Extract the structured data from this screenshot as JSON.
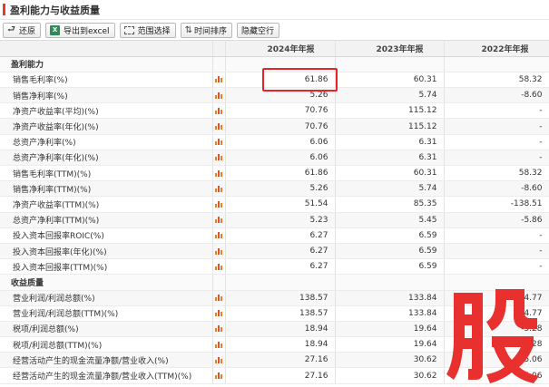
{
  "title": "盈利能力与收益质量",
  "toolbar": {
    "restore": "还原",
    "export": "导出到excel",
    "range": "范围选择",
    "sort": "时间排序",
    "hide_empty": "隐藏空行"
  },
  "columns": [
    "2024年年报",
    "2023年年报",
    "2022年年报"
  ],
  "rows": [
    {
      "section": true,
      "label": "盈利能力"
    },
    {
      "label": "销售毛利率(%)",
      "values": [
        "61.86",
        "60.31",
        "58.32"
      ]
    },
    {
      "label": "销售净利率(%)",
      "values": [
        "5.26",
        "5.74",
        "-8.60"
      ]
    },
    {
      "label": "净资产收益率(平均)(%)",
      "values": [
        "70.76",
        "115.12",
        "-"
      ]
    },
    {
      "label": "净资产收益率(年化)(%)",
      "values": [
        "70.76",
        "115.12",
        "-"
      ]
    },
    {
      "label": "总资产净利率(%)",
      "values": [
        "6.06",
        "6.31",
        "-"
      ]
    },
    {
      "label": "总资产净利率(年化)(%)",
      "values": [
        "6.06",
        "6.31",
        "-"
      ]
    },
    {
      "label": "销售毛利率(TTM)(%)",
      "values": [
        "61.86",
        "60.31",
        "58.32"
      ]
    },
    {
      "label": "销售净利率(TTM)(%)",
      "values": [
        "5.26",
        "5.74",
        "-8.60"
      ]
    },
    {
      "label": "净资产收益率(TTM)(%)",
      "values": [
        "51.54",
        "85.35",
        "-138.51"
      ]
    },
    {
      "label": "总资产净利率(TTM)(%)",
      "values": [
        "5.23",
        "5.45",
        "-5.86"
      ]
    },
    {
      "label": "投入资本回报率ROIC(%)",
      "values": [
        "6.27",
        "6.59",
        "-"
      ]
    },
    {
      "label": "投入资本回报率(年化)(%)",
      "values": [
        "6.27",
        "6.59",
        "-"
      ]
    },
    {
      "label": "投入资本回报率(TTM)(%)",
      "values": [
        "6.27",
        "6.59",
        "-"
      ]
    },
    {
      "section": true,
      "label": "收益质量"
    },
    {
      "label": "营业利润/利润总额(%)",
      "values": [
        "138.57",
        "133.84",
        "64.77"
      ]
    },
    {
      "label": "营业利润/利润总额(TTM)(%)",
      "values": [
        "138.57",
        "133.84",
        "64.77"
      ]
    },
    {
      "label": "税项/利润总额(%)",
      "values": [
        "18.94",
        "19.64",
        "-5.28"
      ]
    },
    {
      "label": "税项/利润总额(TTM)(%)",
      "values": [
        "18.94",
        "19.64",
        "-5.28"
      ]
    },
    {
      "label": "经营活动产生的现金流量净额/营业收入(%)",
      "values": [
        "27.16",
        "30.62",
        "25.06"
      ]
    },
    {
      "label": "经营活动产生的现金流量净额/营业收入(TTM)(%)",
      "values": [
        "27.16",
        "30.62",
        "25.06"
      ]
    }
  ],
  "watermark_text": "股",
  "colors": {
    "accent": "#e23b2e",
    "highlight": "#e0282b",
    "watermark": "#e8302e",
    "chart_icon": "#e8821e"
  },
  "icons": {
    "restore": "back-arrow-icon",
    "export": "excel-icon",
    "range": "range-select-icon",
    "sort": "sort-icon",
    "row_chart": "bar-chart-icon"
  }
}
